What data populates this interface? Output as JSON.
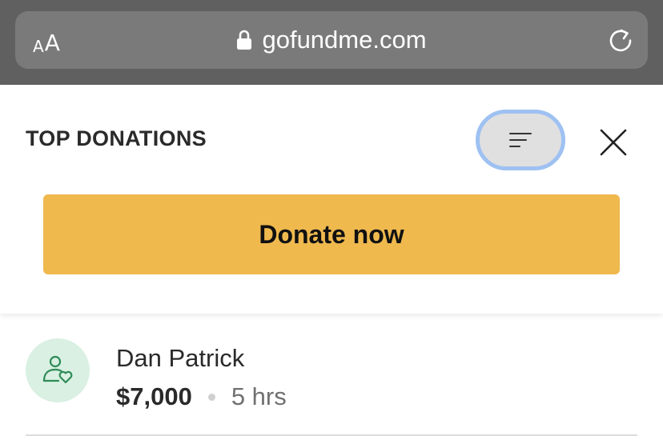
{
  "browser": {
    "text_size_small": "A",
    "text_size_large": "A",
    "url": "gofundme.com"
  },
  "sheet": {
    "title": "TOP DONATIONS",
    "donate_label": "Donate now"
  },
  "donations": [
    {
      "name": "Dan Patrick",
      "amount": "$7,000",
      "time": "5 hrs"
    }
  ],
  "colors": {
    "donate_button": "#efb94e",
    "sort_focus_ring": "#9ec1f2",
    "avatar_bg": "#d9f0e2",
    "avatar_icon": "#2e8b57"
  },
  "icons": [
    "lock-icon",
    "reload-icon",
    "sort-icon",
    "close-icon",
    "donor-heart-icon"
  ]
}
